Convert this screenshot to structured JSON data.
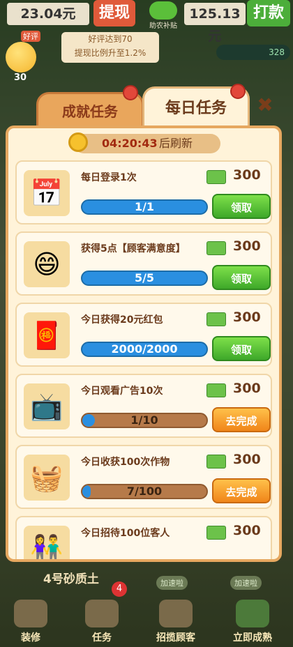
{
  "top": {
    "balance_left": "23.04元",
    "withdraw_btn": "提现",
    "harvest_label": "助农补贴",
    "balance_right": "125.13元",
    "punch_btn": "打款",
    "bubble_line1": "好评达到70",
    "bubble_line2": "提现比例升至1.2%",
    "badge_good": "好评",
    "smiley_count": "30",
    "cash_count": "328"
  },
  "modal": {
    "tab_achievement": "成就任务",
    "tab_daily": "每日任务",
    "close": "✖",
    "timer": "04:20:43",
    "timer_suffix": "后刷新",
    "tasks": [
      {
        "title": "每日登录1次",
        "reward": "300",
        "progress_text": "1/1",
        "progress": 1.0,
        "action": "领取",
        "action_type": "claim",
        "icon": "calendar-check-icon"
      },
      {
        "title": "获得5点【顾客满意度】",
        "reward": "300",
        "progress_text": "5/5",
        "progress": 1.0,
        "action": "领取",
        "action_type": "claim",
        "icon": "smiley-icon"
      },
      {
        "title": "今日获得20元红包",
        "reward": "300",
        "progress_text": "2000/2000",
        "progress": 1.0,
        "action": "领取",
        "action_type": "claim",
        "icon": "red-envelope-icon"
      },
      {
        "title": "今日观看广告10次",
        "reward": "300",
        "progress_text": "1/10",
        "progress": 0.1,
        "action": "去完成",
        "action_type": "go",
        "icon": "tv-play-icon"
      },
      {
        "title": "今日收获100次作物",
        "reward": "300",
        "progress_text": "7/100",
        "progress": 0.07,
        "action": "去完成",
        "action_type": "go",
        "icon": "basket-icon"
      },
      {
        "title": "今日招待100位客人",
        "reward": "300",
        "progress_text": "",
        "progress": 0,
        "action": "",
        "action_type": "go",
        "icon": "customers-icon"
      }
    ]
  },
  "bottom": {
    "field_label": "4号砂质土",
    "speed1": "加速啦",
    "speed2": "加速啦",
    "nav": [
      "装修",
      "任务",
      "招揽顾客",
      "立即成熟"
    ],
    "task_badge": "4"
  },
  "colors": {
    "claim": "#3ea82a",
    "go": "#f0851a",
    "progress_blue": "#2a8fe0",
    "panel_bg": "#fff3d9"
  }
}
